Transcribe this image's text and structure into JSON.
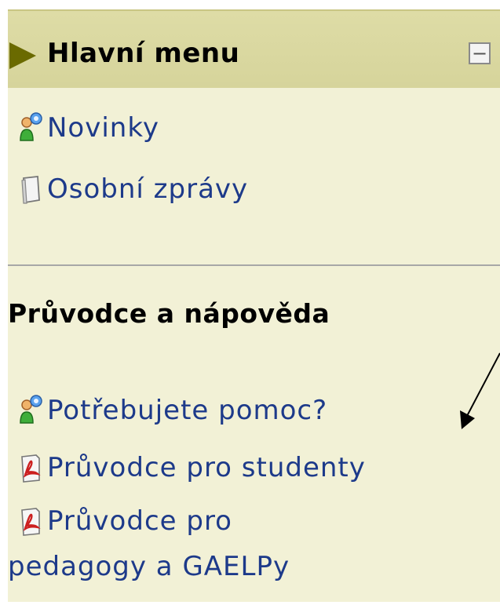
{
  "block": {
    "title": "Hlavní menu",
    "collapse_symbol": "−",
    "items": [
      {
        "label": "Novinky",
        "icon": "news-forum-icon"
      },
      {
        "label": "Osobní zprávy",
        "icon": "messages-document-icon"
      }
    ],
    "section_title": "Průvodce a nápověda",
    "help_items": [
      {
        "label": "Potřebujete pomoc?",
        "icon": "help-forum-icon"
      },
      {
        "label": "Průvodce pro studenty",
        "icon": "pdf-icon"
      },
      {
        "label_line1": "Průvodce pro",
        "label_line2": "pedagogy a GAELPy",
        "icon": "pdf-icon"
      }
    ]
  },
  "colors": {
    "link": "#1d3a8a",
    "header_bg": "#d6d49b",
    "block_bg": "#f2f1d6",
    "triangle": "#6a6a00"
  }
}
